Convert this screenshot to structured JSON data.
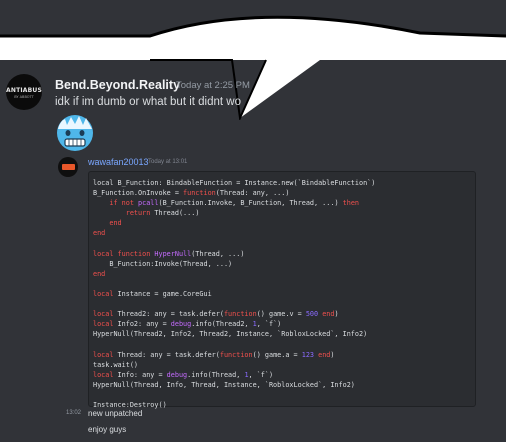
{
  "message": {
    "author": "Bend.Beyond.Reality",
    "timestamp": "Today at 2:25 PM",
    "text": "idk if im dumb or what but it didnt wo",
    "avatar_text": {
      "line1": "ANTIABUSE",
      "line2": "BY ABBOTT"
    }
  },
  "reply": {
    "author": "wawafan20013",
    "timestamp": "Today at 13:01",
    "code_lines": [
      [
        [
          "",
          "local B_Function: BindableFunction = Instance.new(`BindableFunction`)"
        ]
      ],
      [
        [
          "",
          "B_Function.OnInvoke = "
        ],
        [
          "kw",
          "function"
        ],
        [
          "",
          "(Thread: any, ...)"
        ]
      ],
      [
        [
          "",
          "    "
        ],
        [
          "kw",
          "if not"
        ],
        [
          "fn",
          " pcall"
        ],
        [
          "",
          "(B_Function.Invoke, B_Function, Thread, ...) "
        ],
        [
          "kw",
          "then"
        ]
      ],
      [
        [
          "",
          "        "
        ],
        [
          "kw",
          "return"
        ],
        [
          "",
          " Thread(...)"
        ]
      ],
      [
        [
          "kw",
          "    end"
        ]
      ],
      [
        [
          "kw",
          "end"
        ]
      ],
      [
        [
          "",
          ""
        ]
      ],
      [
        [
          "kw",
          "local function"
        ],
        [
          "fn",
          " HyperNull"
        ],
        [
          "",
          "(Thread, ...)"
        ]
      ],
      [
        [
          "",
          "    B_Function:Invoke(Thread, ...)"
        ]
      ],
      [
        [
          "kw",
          "end"
        ]
      ],
      [
        [
          "",
          ""
        ]
      ],
      [
        [
          "kw",
          "local"
        ],
        [
          "",
          " Instance = game.CoreGui"
        ]
      ],
      [
        [
          "",
          ""
        ]
      ],
      [
        [
          "kw",
          "local"
        ],
        [
          "",
          " Thread2: any = task.defer("
        ],
        [
          "kw",
          "function"
        ],
        [
          "",
          "() game.v = "
        ],
        [
          "num",
          "500"
        ],
        [
          "kw",
          " end"
        ],
        [
          "",
          ")"
        ]
      ],
      [
        [
          "kw",
          "local"
        ],
        [
          "",
          " Info2: any = "
        ],
        [
          "fn",
          "debug"
        ],
        [
          "",
          ".info(Thread2, "
        ],
        [
          "num",
          "1"
        ],
        [
          "",
          ", `f`)"
        ]
      ],
      [
        [
          "",
          "HyperNull(Thread2, Info2, Thread2, Instance, `RobloxLocked`, Info2)"
        ]
      ],
      [
        [
          "",
          ""
        ]
      ],
      [
        [
          "kw",
          "local"
        ],
        [
          "",
          " Thread: any = task.defer("
        ],
        [
          "kw",
          "function"
        ],
        [
          "",
          "() game.a = "
        ],
        [
          "num",
          "123"
        ],
        [
          "kw",
          " end"
        ],
        [
          "",
          ")"
        ]
      ],
      [
        [
          "",
          "task.wait()"
        ]
      ],
      [
        [
          "kw",
          "local"
        ],
        [
          "",
          " Info: any = "
        ],
        [
          "fn",
          "debug"
        ],
        [
          "",
          ".info(Thread, "
        ],
        [
          "num",
          "1"
        ],
        [
          "",
          ", `f`)"
        ]
      ],
      [
        [
          "",
          "HyperNull(Thread, Info, Thread, Instance, `RobloxLocked`, Info2)"
        ]
      ],
      [
        [
          "",
          ""
        ]
      ],
      [
        [
          "",
          "Instance:Destroy()"
        ]
      ]
    ]
  },
  "followups": {
    "time": "13:02",
    "line1": "new unpatched",
    "line2": "enjoy guys"
  }
}
